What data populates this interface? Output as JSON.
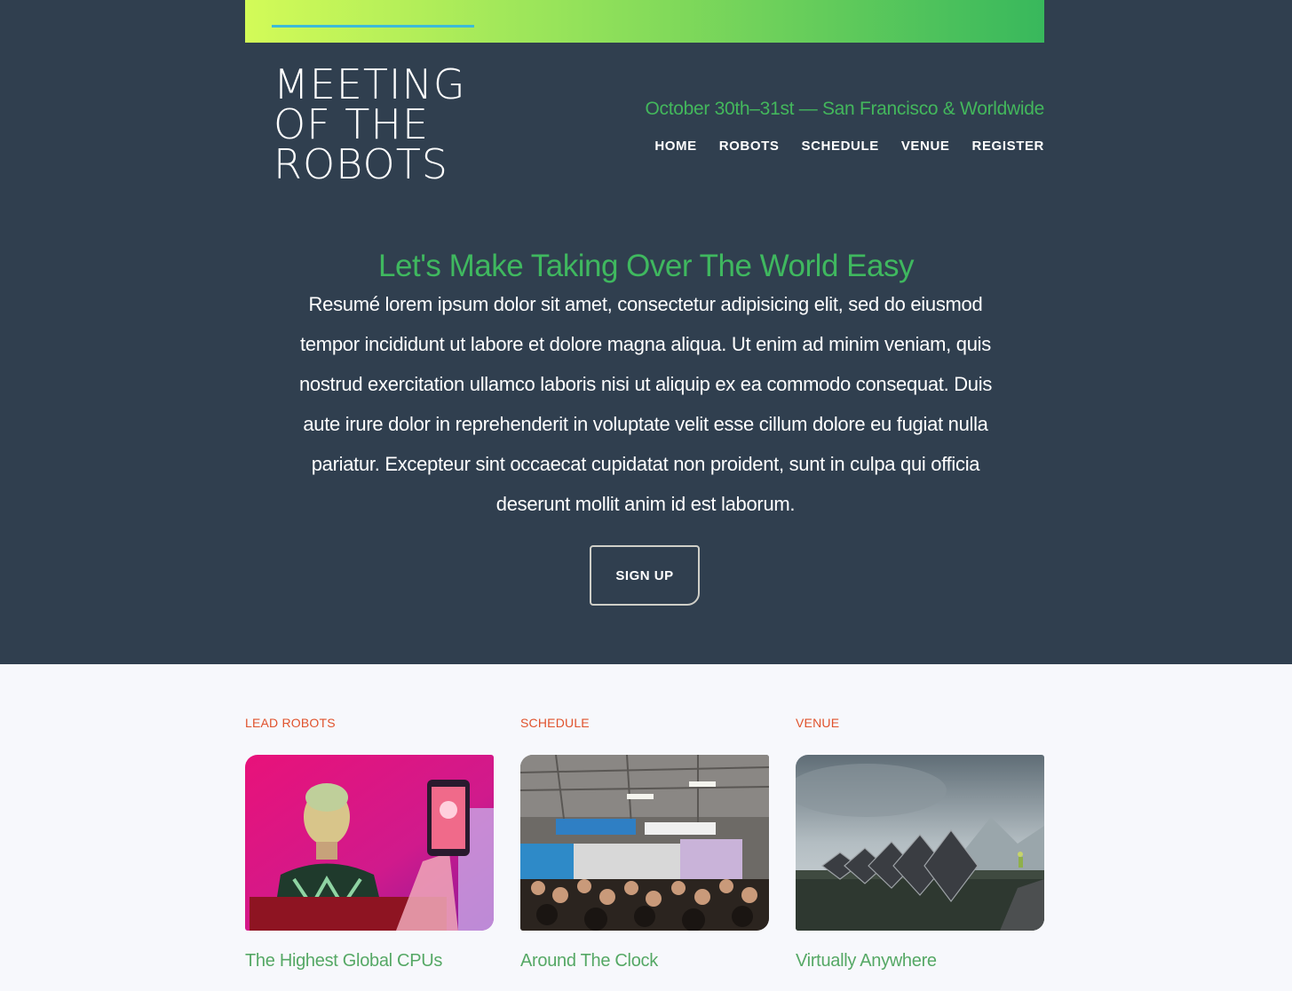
{
  "header": {
    "logo_lines": [
      "MEETING",
      "OF THE",
      "ROBOTS"
    ],
    "event_date": "October 30th–31st — San Francisco & Worldwide",
    "nav": [
      "HOME",
      "ROBOTS",
      "SCHEDULE",
      "VENUE",
      "REGISTER"
    ]
  },
  "hero": {
    "headline": "Let's Make Taking Over The World Easy",
    "body": "Resumé lorem ipsum dolor sit amet, consectetur adipisicing elit, sed do eiusmod tempor incididunt ut labore et dolore magna aliqua. Ut enim ad minim veniam, quis nostrud exercitation ullamco laboris nisi ut aliquip ex ea commodo consequat. Duis aute irure dolor in reprehenderit in voluptate velit esse cillum dolore eu fugiat nulla pariatur. Excepteur sint occaecat cupidatat non proident, sunt in culpa qui officia deserunt mollit anim id est laborum.",
    "cta_label": "SIGN UP"
  },
  "cards": [
    {
      "label": "LEAD ROBOTS",
      "title": "The Highest Global CPUs"
    },
    {
      "label": "SCHEDULE",
      "title": "Around The Clock"
    },
    {
      "label": "VENUE",
      "title": "Virtually Anywhere"
    }
  ],
  "colors": {
    "hero_bg": "#303f4f",
    "accent_green": "#3fb85f",
    "label_orange": "#e0522c",
    "page_bg": "#f7f8fc"
  }
}
